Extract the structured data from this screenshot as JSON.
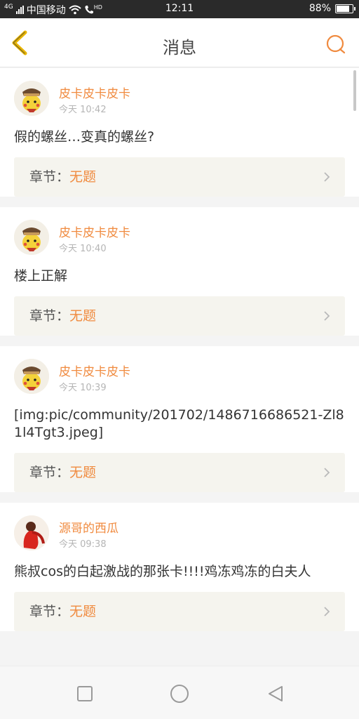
{
  "status_bar": {
    "network": "4G",
    "carrier": "中国移动",
    "hd": "HD",
    "time": "12:11",
    "battery": "88%",
    "battery_level": 0.88
  },
  "header": {
    "title": "消息",
    "back_icon": "chevron-left-icon",
    "search_icon": "search-icon",
    "accent_color": "#f08a3e",
    "back_color": "#e8b400"
  },
  "messages": [
    {
      "user": "皮卡皮卡皮卡",
      "time": "今天 10:42",
      "content": "假的螺丝…变真的螺丝?",
      "chapter_label": "章节：",
      "chapter_value": "无题",
      "avatar": "pikachu-avatar"
    },
    {
      "user": "皮卡皮卡皮卡",
      "time": "今天 10:40",
      "content": "楼上正解",
      "chapter_label": "章节：",
      "chapter_value": "无题",
      "avatar": "pikachu-avatar"
    },
    {
      "user": "皮卡皮卡皮卡",
      "time": "今天 10:39",
      "content": "[img:pic/community/201702/1486716686521-Zl81l4Tgt3.jpeg]",
      "chapter_label": "章节：",
      "chapter_value": "无题",
      "avatar": "pikachu-avatar"
    },
    {
      "user": "源哥的西瓜",
      "time": "今天 09:38",
      "content": "熊叔cos的白起激战的那张卡!!!!鸡冻鸡冻的白夫人",
      "chapter_label": "章节：",
      "chapter_value": "无题",
      "avatar": "red-figure-avatar"
    }
  ],
  "nav_bar": {
    "recent_icon": "square-icon",
    "home_icon": "circle-icon",
    "back_icon": "triangle-back-icon"
  }
}
